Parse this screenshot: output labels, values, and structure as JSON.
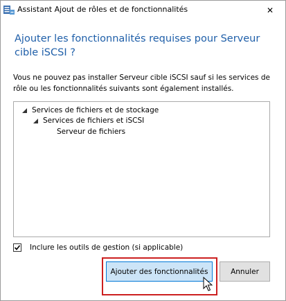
{
  "window": {
    "title": "Assistant Ajout de rôles et de fonctionnalités",
    "close_glyph": "✕"
  },
  "dialog": {
    "heading": "Ajouter les fonctionnalités requises pour Serveur cible iSCSI ?",
    "description": "Vous ne pouvez pas installer Serveur cible iSCSI sauf si les services de rôle ou les fonctionnalités suivants sont également installés.",
    "tree": [
      {
        "label": "Services de fichiers et de stockage",
        "level": 0,
        "expanded": true
      },
      {
        "label": "Services de fichiers et iSCSI",
        "level": 1,
        "expanded": true
      },
      {
        "label": "Serveur de fichiers",
        "level": 2,
        "expanded": false
      }
    ],
    "include_tools": {
      "label": "Inclure les outils de gestion (si applicable)",
      "checked": true
    },
    "buttons": {
      "add_features": "Ajouter des fonctionnalités",
      "cancel": "Annuler"
    }
  },
  "colors": {
    "heading": "#1f5fa9",
    "primary_button_bg": "#cce4f7",
    "primary_button_border": "#0078d7",
    "highlight": "#cc1f1f"
  },
  "icons": {
    "app": "server-manager-icon",
    "expand": "expanded-triangle-icon",
    "check": "checkmark-icon",
    "cursor": "mouse-pointer-icon"
  }
}
